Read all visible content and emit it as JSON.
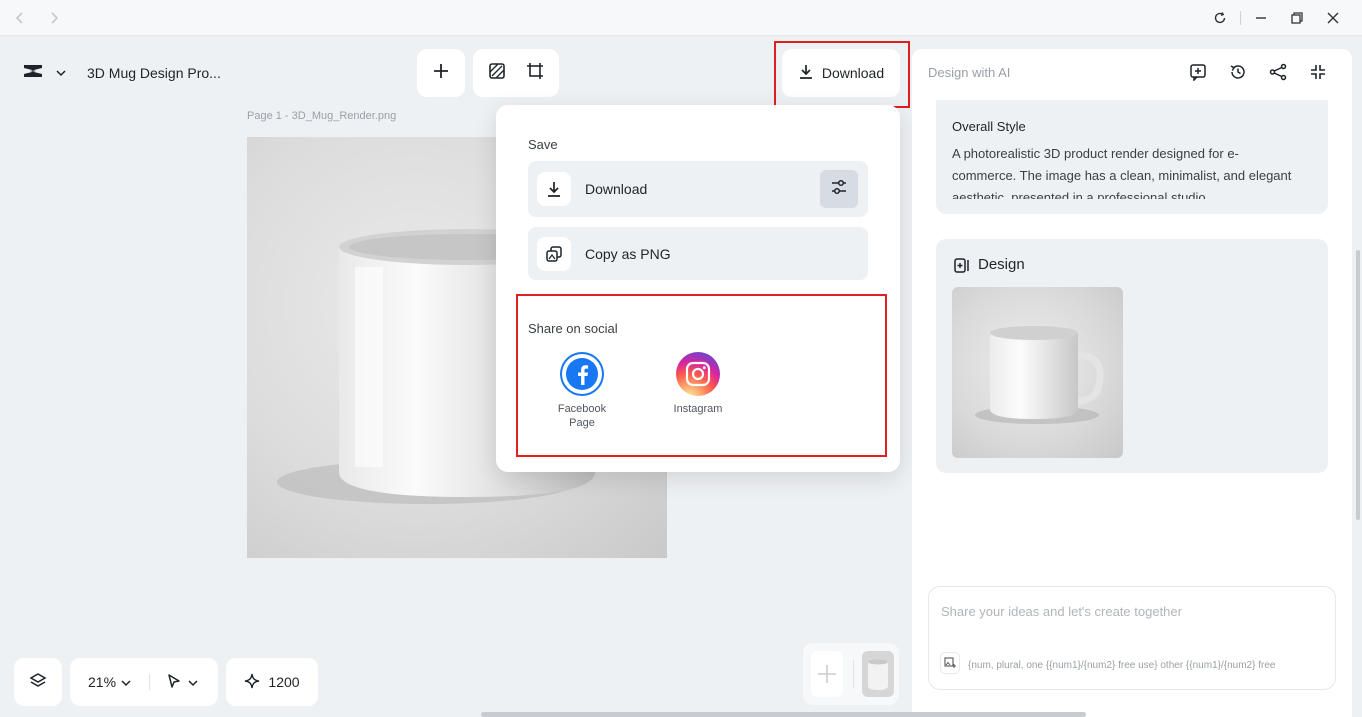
{
  "titlebar": {
    "back_icon": "chevron-left-icon",
    "forward_icon": "chevron-right-icon"
  },
  "project": {
    "title": "3D Mug Design Pro..."
  },
  "canvas": {
    "page_label": "Page 1 -   3D_Mug_Render.png"
  },
  "toolbar": {
    "download_label": "Download"
  },
  "download_menu": {
    "save_heading": "Save",
    "download_label": "Download",
    "copy_label": "Copy as PNG",
    "share_heading": "Share on social",
    "social": [
      {
        "label_line1": "Facebook",
        "label_line2": "Page",
        "color": "#1877f2"
      },
      {
        "label_line1": "Instagram",
        "label_line2": "",
        "color": "#d6249f"
      }
    ]
  },
  "right_panel": {
    "title": "Design with AI",
    "overall_style_heading": "Overall Style",
    "overall_style_text": "A photorealistic 3D product render designed for e-commerce. The image has a clean, minimalist, and elegant aesthetic, presented in a professional studio",
    "design_heading": "Design",
    "chat_placeholder": "Share your ideas and let's create together",
    "chat_meta": "{num, plural, one {{num1}/{num2} free use} other {{num1}/{num2} free"
  },
  "bottom_bar": {
    "zoom": "21%",
    "credits": "1200"
  },
  "colors": {
    "accent_red": "#e0201e",
    "facebook": "#1877f2"
  }
}
